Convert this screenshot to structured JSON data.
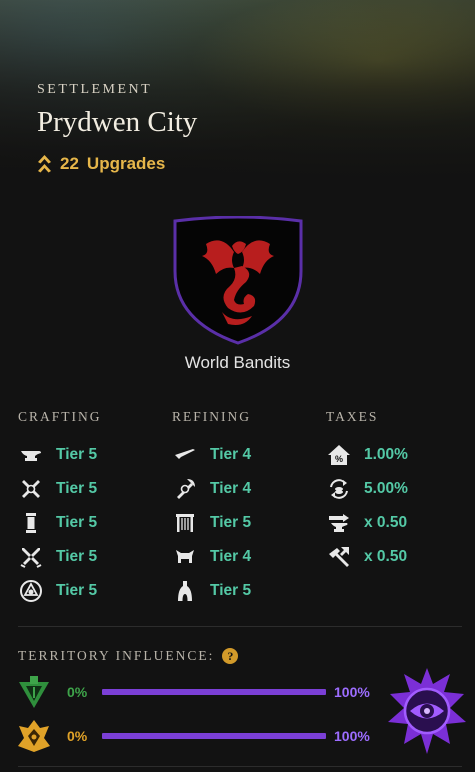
{
  "header": {
    "label": "SETTLEMENT",
    "city_name": "Prydwen City",
    "upgrades_count": "22",
    "upgrades_label": "Upgrades",
    "upgrade_icon": "chevron-up-double-icon"
  },
  "company": {
    "name": "World Bandits",
    "crest_icon": "red-dragon-crest-icon",
    "crest_border_color": "#5a2fa8",
    "crest_fill_color": "#050505",
    "dragon_color": "#b81e1e"
  },
  "crafting": {
    "label": "CRAFTING",
    "items": [
      {
        "icon": "anvil-icon",
        "value": "Tier 5"
      },
      {
        "icon": "crossed-tools-icon",
        "value": "Tier 5"
      },
      {
        "icon": "pillar-icon",
        "value": "Tier 5"
      },
      {
        "icon": "crossed-swords-icon",
        "value": "Tier 5"
      },
      {
        "icon": "compass-circle-icon",
        "value": "Tier 5"
      }
    ]
  },
  "refining": {
    "label": "REFINING",
    "items": [
      {
        "icon": "blade-icon",
        "value": "Tier 4"
      },
      {
        "icon": "axe-hammer-icon",
        "value": "Tier 4"
      },
      {
        "icon": "loom-frame-icon",
        "value": "Tier 5"
      },
      {
        "icon": "tanning-rack-icon",
        "value": "Tier 4"
      },
      {
        "icon": "kiln-icon",
        "value": "Tier 5"
      }
    ]
  },
  "taxes": {
    "label": "TAXES",
    "items": [
      {
        "icon": "house-tax-icon",
        "value": "1.00%"
      },
      {
        "icon": "coin-cycle-icon",
        "value": "5.00%"
      },
      {
        "icon": "anvil-arrow-icon",
        "value": "x 0.50"
      },
      {
        "icon": "hammer-arrow-icon",
        "value": "x 0.50"
      }
    ]
  },
  "influence": {
    "label": "TERRITORY INFLUENCE:",
    "help_icon": "question-mark-icon",
    "help_text": "?",
    "rows": [
      {
        "emblem": "covenant-emblem-icon",
        "start": "0%",
        "end": "100%",
        "start_color": "#3ea44a"
      },
      {
        "emblem": "marauder-emblem-icon",
        "start": "0%",
        "end": "100%",
        "start_color": "#e0a228"
      }
    ],
    "owner_emblem": "syndicate-eye-emblem-icon",
    "bar_color": "#7b3fd6"
  }
}
